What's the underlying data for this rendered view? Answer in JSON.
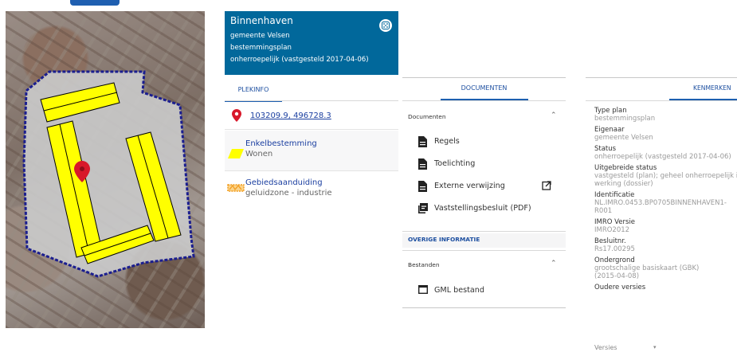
{
  "map": {
    "description_colors": {
      "plan_area": "#c9c9c9",
      "building": "#ffff00",
      "boundary": "#1b1e8f"
    }
  },
  "panel1": {
    "title": "Binnenhaven",
    "municipality": "gemeente Velsen",
    "plan_type": "bestemmingsplan",
    "status": "onherroepelijk (vastgesteld 2017-04-06)",
    "tab": "PLEKINFO",
    "coordinates": "103209.9, 496728.3",
    "items": [
      {
        "title": "Enkelbestemming",
        "sub": "Wonen"
      },
      {
        "title": "Gebiedsaanduiding",
        "sub": "geluidzone - industrie"
      }
    ]
  },
  "panel2": {
    "tab": "DOCUMENTEN",
    "documents_header": "Documenten",
    "documents": [
      "Regels",
      "Toelichting",
      "Externe verwijzing",
      "Vaststellingsbesluit (PDF)"
    ],
    "other_header": "OVERIGE INFORMATIE",
    "files_header": "Bestanden",
    "files": [
      "GML bestand"
    ]
  },
  "panel3": {
    "tab": "KENMERKEN",
    "fields": [
      {
        "label": "Type plan",
        "value": "bestemmingsplan"
      },
      {
        "label": "Eigenaar",
        "value": "gemeente Velsen"
      },
      {
        "label": "Status",
        "value": "onherroepelijk (vastgesteld 2017-04-06)"
      },
      {
        "label": "Uitgebreide status",
        "value": "vastgesteld (plan); geheel onherroepelijk in",
        "value2": "werking (dossier)"
      },
      {
        "label": "Identificatie",
        "value": "NL.IMRO.0453.BP0705BINNENHAVEN1-",
        "value2": "R001"
      },
      {
        "label": "IMRO Versie",
        "value": "IMRO2012"
      },
      {
        "label": "Besluitnr.",
        "value": "Rs17.00295"
      },
      {
        "label": "Ondergrond",
        "value": "grootschalige basiskaart (GBK)",
        "value2": "(2015-04-08)"
      },
      {
        "label": "Oudere versies",
        "value": ""
      }
    ],
    "versions_label": "Versies"
  }
}
